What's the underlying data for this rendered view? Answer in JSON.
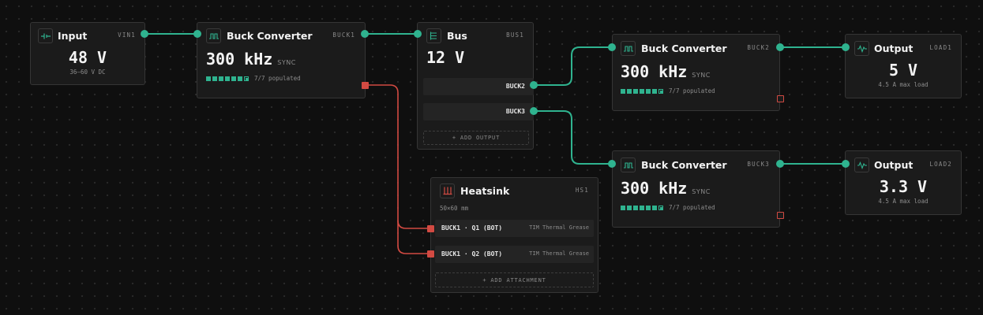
{
  "colors": {
    "accent": "#2fb38f",
    "thermal": "#d24a42",
    "node_bg": "#1b1b1b",
    "canvas": "#0f0f0f"
  },
  "nodes": {
    "input": {
      "icon": "dc-source-icon",
      "title": "Input",
      "id": "VIN1",
      "value": "48 V",
      "note": "36–60 V DC"
    },
    "buck1": {
      "icon": "switching-waveform-icon",
      "title": "Buck Converter",
      "id": "BUCK1",
      "value": "300 kHz",
      "mode": "SYNC",
      "slots_filled": 7,
      "slots_total": 7,
      "populated": "7/7 populated"
    },
    "bus": {
      "icon": "bus-icon",
      "title": "Bus",
      "id": "BUS1",
      "value": "12 V",
      "outputs": [
        "BUCK2",
        "BUCK3"
      ],
      "add_label": "+ ADD OUTPUT"
    },
    "buck2": {
      "icon": "switching-waveform-icon",
      "title": "Buck Converter",
      "id": "BUCK2",
      "value": "300 kHz",
      "mode": "SYNC",
      "slots_filled": 7,
      "slots_total": 7,
      "populated": "7/7 populated"
    },
    "buck3": {
      "icon": "switching-waveform-icon",
      "title": "Buck Converter",
      "id": "BUCK3",
      "value": "300 kHz",
      "mode": "SYNC",
      "slots_filled": 7,
      "slots_total": 7,
      "populated": "7/7 populated"
    },
    "load1": {
      "icon": "output-waveform-icon",
      "title": "Output",
      "id": "LOAD1",
      "value": "5 V",
      "note": "4.5 A max load"
    },
    "load2": {
      "icon": "output-waveform-icon",
      "title": "Output",
      "id": "LOAD2",
      "value": "3.3 V",
      "note": "4.5 A max load"
    },
    "heatsink": {
      "icon": "heatsink-icon",
      "title": "Heatsink",
      "id": "HS1",
      "size": "50×60 mm",
      "attachments": [
        {
          "part": "BUCK1 · Q1 (BOT)",
          "interface": "TIM Thermal Grease"
        },
        {
          "part": "BUCK1 · Q2 (BOT)",
          "interface": "TIM Thermal Grease"
        }
      ],
      "add_label": "+ ADD ATTACHMENT"
    }
  }
}
